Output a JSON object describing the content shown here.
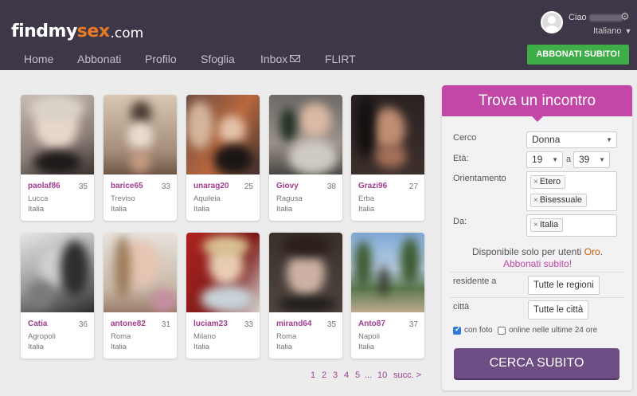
{
  "header": {
    "logo": {
      "part1": "find",
      "part2": "my",
      "part3": "sex",
      "part4": ".com"
    },
    "greeting": "Ciao",
    "language": "Italiano",
    "subscribe_button": "ABBONATI SUBITO!"
  },
  "nav": {
    "items": [
      {
        "label": "Home"
      },
      {
        "label": "Abbonati"
      },
      {
        "label": "Profilo"
      },
      {
        "label": "Sfoglia"
      },
      {
        "label": "Inbox"
      },
      {
        "label": "FLIRT"
      }
    ]
  },
  "profiles": [
    {
      "name": "paolaf86",
      "age": "35",
      "city": "Lucca",
      "country": "Italia"
    },
    {
      "name": "barice65",
      "age": "33",
      "city": "Treviso",
      "country": "Italia"
    },
    {
      "name": "unarag20",
      "age": "25",
      "city": "Aquileia",
      "country": "Italia"
    },
    {
      "name": "Giovy",
      "age": "38",
      "city": "Ragusa",
      "country": "Italia"
    },
    {
      "name": "Grazi96",
      "age": "27",
      "city": "Erba",
      "country": "Italia"
    },
    {
      "name": "Catia",
      "age": "36",
      "city": "Agropoli",
      "country": "Italia"
    },
    {
      "name": "antone82",
      "age": "31",
      "city": "Roma",
      "country": "Italia"
    },
    {
      "name": "luciam23",
      "age": "33",
      "city": "Milano",
      "country": "Italia"
    },
    {
      "name": "mirand64",
      "age": "35",
      "city": "Roma",
      "country": "Italia"
    },
    {
      "name": "Anto87",
      "age": "37",
      "city": "Napoli",
      "country": "Italia"
    }
  ],
  "pagination": {
    "pages": [
      "1",
      "2",
      "3",
      "4",
      "5"
    ],
    "ellipsis": "...",
    "last": "10",
    "next": "succ. >"
  },
  "search_panel": {
    "title": "Trova un incontro",
    "seek_label": "Cerco",
    "seek_value": "Donna",
    "age_label": "Età:",
    "age_from": "19",
    "age_sep": "a",
    "age_to": "39",
    "orientation_label": "Orientamento",
    "orientation_tags": [
      "Etero",
      "Bisessuale"
    ],
    "from_label": "Da:",
    "from_tags": [
      "Italia"
    ],
    "gold_note": "Disponibile solo per utenti",
    "gold_word": "Oro",
    "gold_link": "Abbonati subito!",
    "resident_label": "residente a",
    "resident_value": "Tutte le regioni",
    "city_label": "città",
    "city_value": "Tutte le città",
    "with_photo_label": "con foto",
    "with_photo_checked": true,
    "online_label": "online nelle ultime 24 ore",
    "online_checked": false,
    "search_button": "CERCA SUBITO"
  },
  "colors": {
    "header_bg": "#3d3747",
    "accent_pink": "#c247a6",
    "logo_orange": "#e97a24",
    "subscribe_green": "#3fae49",
    "search_button": "#6d4d83"
  }
}
